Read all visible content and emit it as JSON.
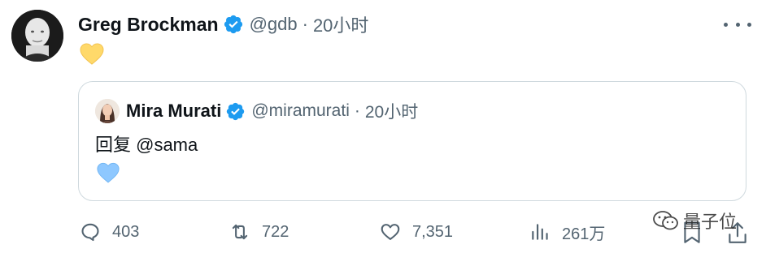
{
  "tweet": {
    "author_name": "Greg Brockman",
    "handle": "@gdb",
    "separator": "·",
    "time": "20小时",
    "emoji_icon": "yellow-heart-icon",
    "verified_color": "#1d9bf0"
  },
  "quoted": {
    "author_name": "Mira Murati",
    "handle": "@miramurati",
    "separator": "·",
    "time": "20小时",
    "text": "回复 @sama",
    "emoji_icon": "blue-heart-icon"
  },
  "actions": {
    "replies": "403",
    "retweets": "722",
    "likes": "7,351",
    "views": "261万"
  },
  "watermark": {
    "text": "量子位"
  },
  "colors": {
    "secondary_text": "#536471",
    "border": "#cfd9de",
    "yellow_heart": "#ffd96a",
    "blue_heart": "#8ec8ff"
  }
}
